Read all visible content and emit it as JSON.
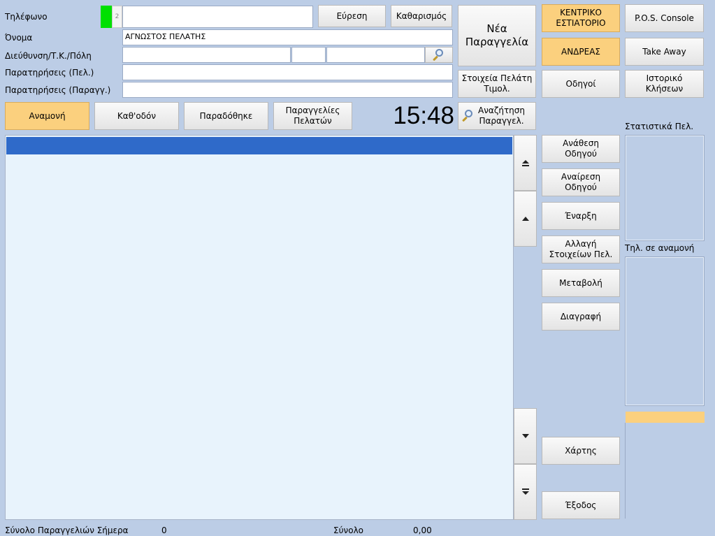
{
  "customer_form": {
    "phone_label": "Τηλέφωνο",
    "phone_line_number": "2",
    "phone_value": "",
    "name_label": "Όνομα",
    "name_value": "ΑΓΝΩΣΤΟΣ ΠΕΛΑΤΗΣ",
    "address_label": "Διεύθυνση/Τ.Κ./Πόλη",
    "customer_notes_label": "Παρατηρήσεις (Πελ.)",
    "order_notes_label": "Παρατηρήσεις (Παραγγ.)"
  },
  "buttons": {
    "find": "Εύρεση",
    "clear": "Καθαρισμός",
    "new_order": "Νέα\nΠαραγγελία",
    "customer_invoice": "Στοιχεία Πελάτη\nΤιμολ.",
    "restaurant": "ΚΕΝΤΡΙΚΟ\nΕΣΤΙΑΤΟΡΙΟ",
    "pos_console": "P.O.S. Console",
    "user": "ΑΝΔΡΕΑΣ",
    "take_away": "Take Away",
    "drivers": "Οδηγοί",
    "call_history": "Ιστορικό\nΚλήσεων",
    "search_order": "Αναζήτηση\nΠαραγγελ.",
    "assign_driver": "Ανάθεση\nΟδηγού",
    "remove_driver": "Αναίρεση\nΟδηγού",
    "start": "Έναρξη",
    "change_customer": "Αλλαγή\nΣτοιχείων Πελ.",
    "modify": "Μεταβολή",
    "delete": "Διαγραφή",
    "map": "Χάρτης",
    "exit": "Έξοδος"
  },
  "tabs": {
    "waiting": "Αναμονή",
    "on_the_way": "Καθ'οδόν",
    "delivered": "Παραδόθηκε",
    "customer_orders": "Παραγγελίες\nΠελατών"
  },
  "clock": "15:48",
  "side": {
    "stats_label": "Στατιστικά Πελ.",
    "waiting_calls_label": "Τηλ. σε αναμονή"
  },
  "footer": {
    "orders_today_label": "Σύνολο Παραγγελιών Σήμερα",
    "orders_today_value": "0",
    "total_label": "Σύνολο",
    "total_value": "0,00"
  },
  "colors": {
    "background": "#bccde6",
    "accent_orange": "#fbd07e",
    "selection_blue": "#2f6ac9",
    "phone_status_green": "#00e000",
    "grid_background": "#e8f3fc"
  }
}
